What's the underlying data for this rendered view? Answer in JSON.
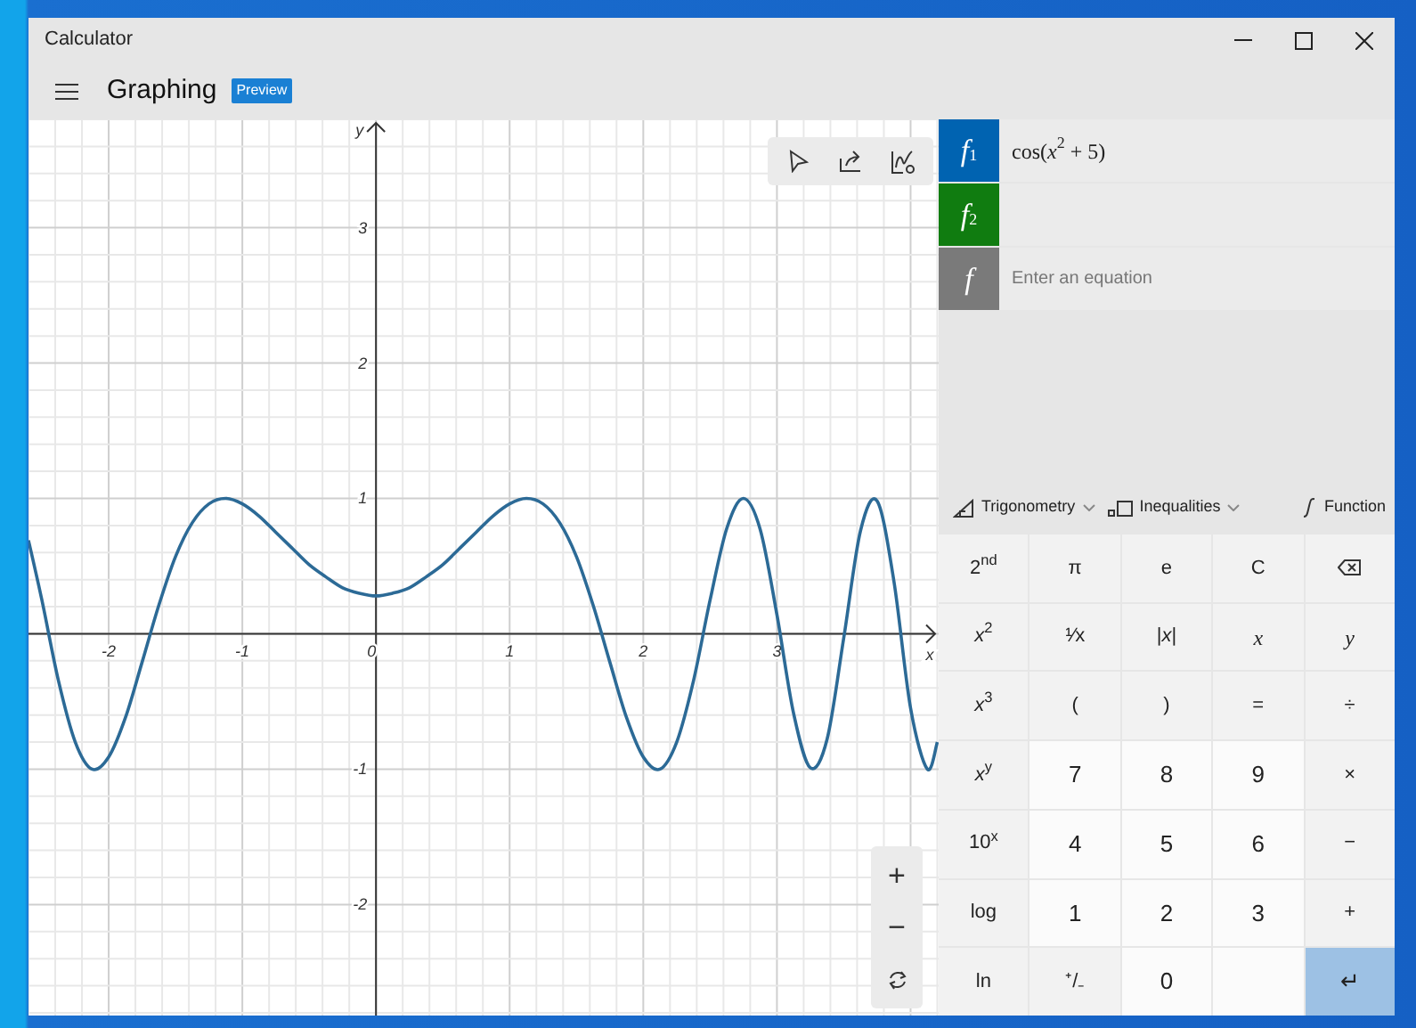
{
  "window": {
    "title": "Calculator"
  },
  "header": {
    "mode": "Graphing",
    "badge": "Preview"
  },
  "graph": {
    "chart_data": {
      "type": "line",
      "grid": true,
      "xlabel": "x",
      "ylabel": "y",
      "xlim": [
        -2.6,
        4.21
      ],
      "ylim": [
        -2.82,
        3.8
      ],
      "xticks": [
        -2,
        -1,
        0,
        1,
        2,
        3
      ],
      "yticks": [
        -2,
        -1,
        1,
        2,
        3
      ],
      "x": [
        -2.6,
        -2.5,
        -2.375,
        -2.25,
        -2.125,
        -2,
        -1.875,
        -1.75,
        -1.625,
        -1.5,
        -1.375,
        -1.25,
        -1.125,
        -1,
        -0.875,
        -0.75,
        -0.625,
        -0.5,
        -0.375,
        -0.25,
        -0.125,
        0,
        0.125,
        0.25,
        0.375,
        0.5,
        0.625,
        0.75,
        0.875,
        1,
        1.125,
        1.25,
        1.375,
        1.5,
        1.625,
        1.75,
        1.875,
        2,
        2.125,
        2.25,
        2.375,
        2.5,
        2.625,
        2.75,
        2.875,
        3,
        3.125,
        3.25,
        3.375,
        3.5,
        3.625,
        3.75,
        3.875,
        4,
        4.125,
        4.2
      ],
      "series": [
        {
          "color": "#2c6a96",
          "values": [
            0.69,
            0.25,
            -0.35,
            -0.8,
            -1,
            -0.91,
            -0.62,
            -0.21,
            0.21,
            0.57,
            0.82,
            0.96,
            1,
            0.96,
            0.87,
            0.75,
            0.63,
            0.51,
            0.42,
            0.34,
            0.3,
            0.28,
            0.3,
            0.34,
            0.42,
            0.51,
            0.63,
            0.75,
            0.87,
            0.96,
            1,
            0.96,
            0.82,
            0.57,
            0.21,
            -0.21,
            -0.62,
            -0.91,
            -1,
            -0.8,
            -0.35,
            0.25,
            0.78,
            1,
            0.77,
            0.14,
            -0.59,
            -0.99,
            -0.78,
            -0.03,
            0.76,
            0.98,
            0.39,
            -0.55,
            -1,
            -0.8
          ]
        }
      ]
    },
    "zoom_controls": {
      "zoom_in": "+",
      "zoom_out": "−"
    }
  },
  "functions": [
    {
      "label": "f$_{1}$",
      "color": "#0063b1",
      "expression": "cos(*x*$^{2}$ + 5)"
    },
    {
      "label": "f$_{2}$",
      "color": "#107c10"
    },
    {
      "label": "f",
      "color": "#7a7a7a",
      "placeholder": "Enter an equation"
    }
  ],
  "keypad_toolbar": [
    {
      "label": "Trigonometry",
      "kind": "dropdown"
    },
    {
      "label": "Inequalities",
      "kind": "dropdown"
    },
    {
      "label": "Function",
      "kind": "plain"
    }
  ],
  "keys": [
    {
      "label": "2$^{nd}$",
      "kind": "fn"
    },
    {
      "label": "π",
      "kind": "fn"
    },
    {
      "label": "e",
      "kind": "fn"
    },
    {
      "label": "C",
      "kind": "fn"
    },
    {
      "kind": "backspace"
    },
    {
      "label": "*x*$^{2}$",
      "kind": "fn"
    },
    {
      "label": "¹⁄x",
      "kind": "fn"
    },
    {
      "label": "|*x*|",
      "kind": "fn"
    },
    {
      "label": "x",
      "kind": "var"
    },
    {
      "label": "y",
      "kind": "var"
    },
    {
      "label": "*x*$^{3}$",
      "kind": "fn"
    },
    {
      "label": "(",
      "kind": "fn"
    },
    {
      "label": ")",
      "kind": "fn"
    },
    {
      "label": "=",
      "kind": "fn"
    },
    {
      "label": "÷",
      "kind": "fn"
    },
    {
      "label": "*x*$^{y}$",
      "kind": "fn"
    },
    {
      "label": "7",
      "kind": "num"
    },
    {
      "label": "8",
      "kind": "num"
    },
    {
      "label": "9",
      "kind": "num"
    },
    {
      "label": "×",
      "kind": "fn"
    },
    {
      "label": "10$^{x}$",
      "kind": "fn"
    },
    {
      "label": "4",
      "kind": "num"
    },
    {
      "label": "5",
      "kind": "num"
    },
    {
      "label": "6",
      "kind": "num"
    },
    {
      "label": "−",
      "kind": "fn"
    },
    {
      "label": "log",
      "kind": "fn"
    },
    {
      "label": "1",
      "kind": "num"
    },
    {
      "label": "2",
      "kind": "num"
    },
    {
      "label": "3",
      "kind": "num"
    },
    {
      "label": "+",
      "kind": "fn"
    },
    {
      "label": "ln",
      "kind": "fn"
    },
    {
      "label": "⁺/₋",
      "kind": "fn"
    },
    {
      "label": "0",
      "kind": "num"
    },
    {
      "kind": "num"
    },
    {
      "label": "↵",
      "kind": "enter"
    }
  ]
}
